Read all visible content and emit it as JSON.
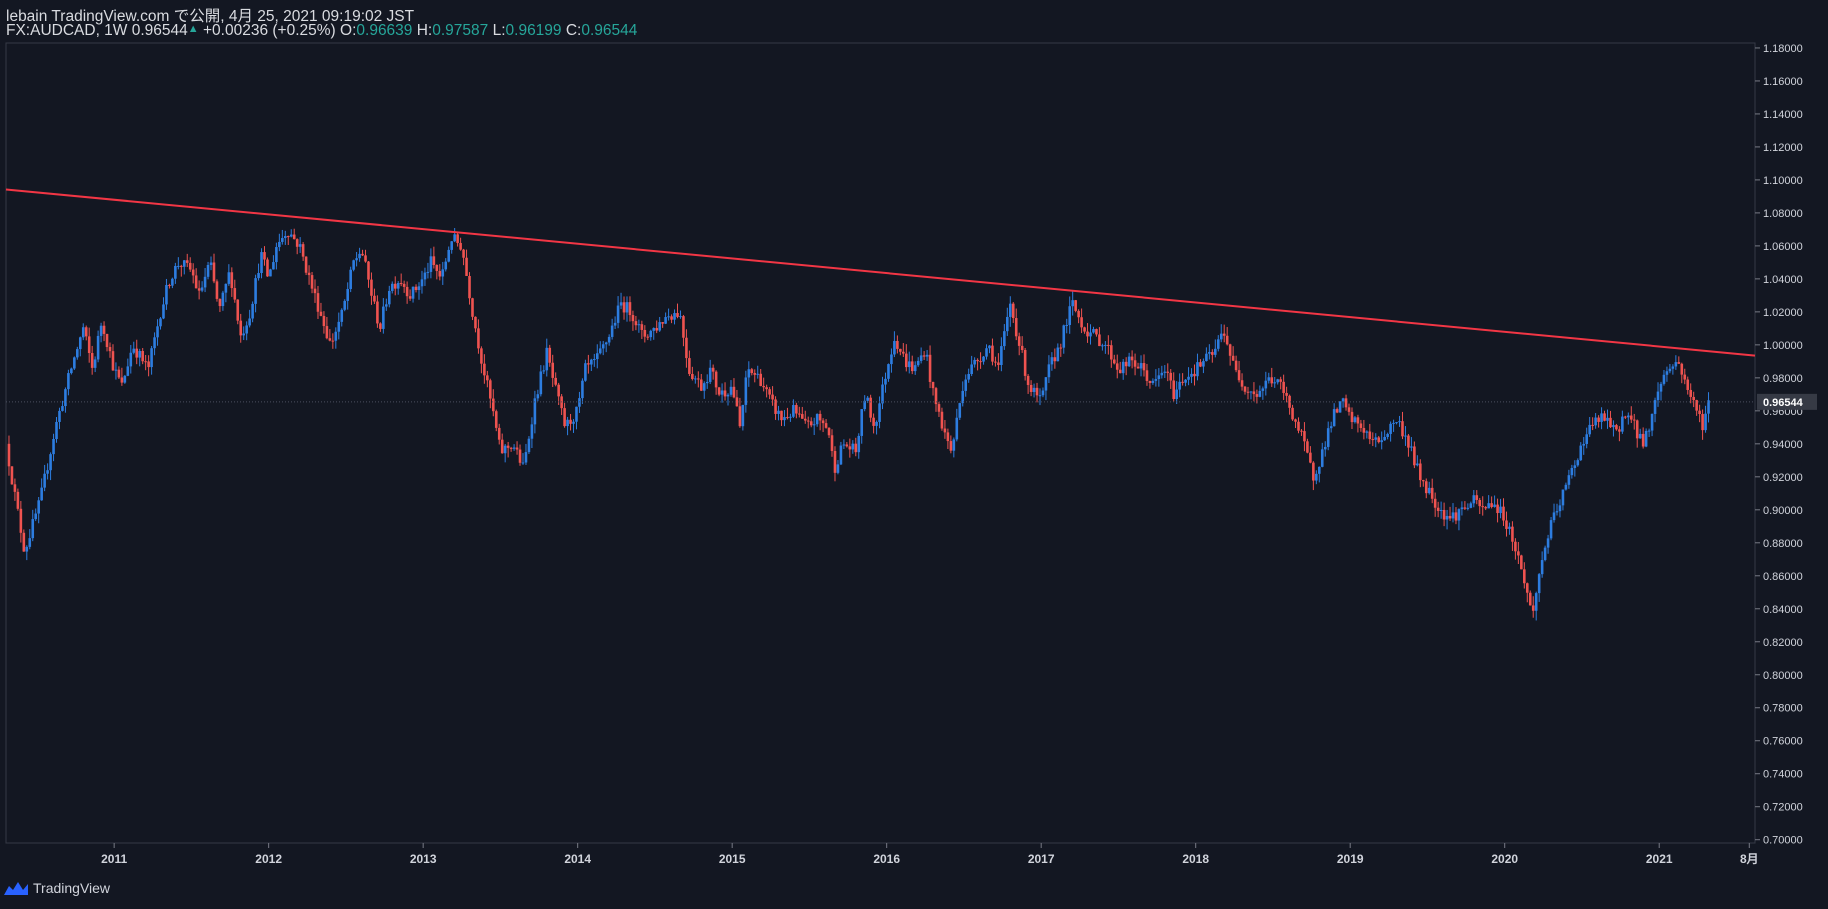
{
  "header": {
    "publish_text": "lebain TradingView.com で公開, 4月 25, 2021 09:19:02 JST",
    "symbol": "FX:AUDCAD, 1W",
    "last": "0.96544",
    "change": "+0.00236 (+0.25%)",
    "o_label": "O:",
    "o_value": "0.96639",
    "h_label": "H:",
    "h_value": "0.97587",
    "l_label": "L:",
    "l_value": "0.96199",
    "c_label": "C:",
    "c_value": "0.96544"
  },
  "footer": {
    "brand": "TradingView",
    "logo_icon": "tradingview-logo-icon"
  },
  "chart_data": {
    "type": "candlestick",
    "timeframe": "1W",
    "x_ticks": [
      "2011",
      "2012",
      "2013",
      "2014",
      "2015",
      "2016",
      "2017",
      "2018",
      "2019",
      "2020",
      "2021",
      "8月"
    ],
    "x_tick_years": [
      2011,
      2012,
      2013,
      2014,
      2015,
      2016,
      2017,
      2018,
      2019,
      2020,
      2021,
      2021.583
    ],
    "x_range": [
      2010.3,
      2021.62
    ],
    "y_ticks": [
      "1.18000",
      "1.16000",
      "1.14000",
      "1.12000",
      "1.10000",
      "1.08000",
      "1.06000",
      "1.04000",
      "1.02000",
      "1.00000",
      "0.98000",
      "0.96000",
      "0.94000",
      "0.92000",
      "0.90000",
      "0.88000",
      "0.86000",
      "0.84000",
      "0.82000",
      "0.80000",
      "0.78000",
      "0.76000",
      "0.74000",
      "0.72000",
      "0.70000"
    ],
    "ylim": [
      0.698,
      1.183
    ],
    "last_price_label": "0.96544",
    "last_price": 0.96544,
    "trendline": {
      "color": "#f23645",
      "from": [
        2010.3,
        1.0942
      ],
      "to": [
        2021.62,
        0.9935
      ]
    },
    "up_color": "#2d7de0",
    "down_color": "#ef5350",
    "closes_path": [
      [
        2010.3,
        0.94
      ],
      [
        2010.42,
        0.875
      ],
      [
        2010.52,
        0.905
      ],
      [
        2010.62,
        0.95
      ],
      [
        2010.72,
        0.985
      ],
      [
        2010.8,
        1.01
      ],
      [
        2010.86,
        0.985
      ],
      [
        2010.92,
        1.015
      ],
      [
        2011.0,
        0.985
      ],
      [
        2011.05,
        0.975
      ],
      [
        2011.12,
        1.0
      ],
      [
        2011.22,
        0.985
      ],
      [
        2011.3,
        1.02
      ],
      [
        2011.36,
        1.04
      ],
      [
        2011.42,
        1.05
      ],
      [
        2011.5,
        1.045
      ],
      [
        2011.55,
        1.03
      ],
      [
        2011.62,
        1.05
      ],
      [
        2011.68,
        1.02
      ],
      [
        2011.75,
        1.045
      ],
      [
        2011.82,
        1.005
      ],
      [
        2011.88,
        1.02
      ],
      [
        2011.95,
        1.055
      ],
      [
        2012.0,
        1.04
      ],
      [
        2012.05,
        1.06
      ],
      [
        2012.12,
        1.07
      ],
      [
        2012.2,
        1.06
      ],
      [
        2012.28,
        1.035
      ],
      [
        2012.35,
        1.015
      ],
      [
        2012.4,
        1.0
      ],
      [
        2012.48,
        1.02
      ],
      [
        2012.55,
        1.05
      ],
      [
        2012.6,
        1.058
      ],
      [
        2012.68,
        1.025
      ],
      [
        2012.72,
        1.01
      ],
      [
        2012.78,
        1.035
      ],
      [
        2012.85,
        1.04
      ],
      [
        2012.92,
        1.03
      ],
      [
        2013.0,
        1.04
      ],
      [
        2013.05,
        1.05
      ],
      [
        2013.12,
        1.04
      ],
      [
        2013.18,
        1.065
      ],
      [
        2013.25,
        1.06
      ],
      [
        2013.32,
        1.02
      ],
      [
        2013.38,
        0.99
      ],
      [
        2013.45,
        0.96
      ],
      [
        2013.5,
        0.935
      ],
      [
        2013.58,
        0.94
      ],
      [
        2013.65,
        0.925
      ],
      [
        2013.72,
        0.965
      ],
      [
        2013.8,
        0.995
      ],
      [
        2013.85,
        0.975
      ],
      [
        2013.92,
        0.95
      ],
      [
        2014.0,
        0.96
      ],
      [
        2014.05,
        0.985
      ],
      [
        2014.12,
        0.99
      ],
      [
        2014.2,
        1.005
      ],
      [
        2014.28,
        1.025
      ],
      [
        2014.35,
        1.02
      ],
      [
        2014.42,
        1.005
      ],
      [
        2014.5,
        1.01
      ],
      [
        2014.58,
        1.018
      ],
      [
        2014.66,
        1.02
      ],
      [
        2014.72,
        0.985
      ],
      [
        2014.8,
        0.975
      ],
      [
        2014.86,
        0.985
      ],
      [
        2014.92,
        0.97
      ],
      [
        2015.0,
        0.975
      ],
      [
        2015.05,
        0.95
      ],
      [
        2015.1,
        0.985
      ],
      [
        2015.18,
        0.98
      ],
      [
        2015.25,
        0.965
      ],
      [
        2015.32,
        0.955
      ],
      [
        2015.4,
        0.96
      ],
      [
        2015.48,
        0.95
      ],
      [
        2015.55,
        0.955
      ],
      [
        2015.62,
        0.95
      ],
      [
        2015.66,
        0.925
      ],
      [
        2015.72,
        0.94
      ],
      [
        2015.8,
        0.935
      ],
      [
        2015.86,
        0.97
      ],
      [
        2015.92,
        0.95
      ],
      [
        2016.0,
        0.985
      ],
      [
        2016.05,
        1.005
      ],
      [
        2016.12,
        0.99
      ],
      [
        2016.18,
        0.985
      ],
      [
        2016.25,
        0.998
      ],
      [
        2016.3,
        0.97
      ],
      [
        2016.38,
        0.945
      ],
      [
        2016.42,
        0.935
      ],
      [
        2016.5,
        0.98
      ],
      [
        2016.58,
        0.99
      ],
      [
        2016.66,
        1.0
      ],
      [
        2016.72,
        0.985
      ],
      [
        2016.8,
        1.025
      ],
      [
        2016.86,
        1.0
      ],
      [
        2016.92,
        0.975
      ],
      [
        2017.0,
        0.965
      ],
      [
        2017.05,
        0.985
      ],
      [
        2017.12,
        1.0
      ],
      [
        2017.2,
        1.025
      ],
      [
        2017.28,
        1.01
      ],
      [
        2017.35,
        1.005
      ],
      [
        2017.42,
        1.0
      ],
      [
        2017.5,
        0.985
      ],
      [
        2017.58,
        0.99
      ],
      [
        2017.66,
        0.985
      ],
      [
        2017.72,
        0.975
      ],
      [
        2017.8,
        0.985
      ],
      [
        2017.86,
        0.97
      ],
      [
        2017.92,
        0.98
      ],
      [
        2018.0,
        0.985
      ],
      [
        2018.05,
        0.99
      ],
      [
        2018.12,
        0.995
      ],
      [
        2018.18,
        1.01
      ],
      [
        2018.25,
        0.985
      ],
      [
        2018.32,
        0.975
      ],
      [
        2018.4,
        0.97
      ],
      [
        2018.48,
        0.98
      ],
      [
        2018.55,
        0.975
      ],
      [
        2018.62,
        0.96
      ],
      [
        2018.7,
        0.94
      ],
      [
        2018.76,
        0.92
      ],
      [
        2018.82,
        0.935
      ],
      [
        2018.88,
        0.955
      ],
      [
        2018.95,
        0.965
      ],
      [
        2019.0,
        0.955
      ],
      [
        2019.08,
        0.95
      ],
      [
        2019.15,
        0.94
      ],
      [
        2019.22,
        0.945
      ],
      [
        2019.3,
        0.955
      ],
      [
        2019.38,
        0.94
      ],
      [
        2019.45,
        0.92
      ],
      [
        2019.52,
        0.91
      ],
      [
        2019.58,
        0.9
      ],
      [
        2019.65,
        0.895
      ],
      [
        2019.72,
        0.9
      ],
      [
        2019.8,
        0.905
      ],
      [
        2019.86,
        0.9
      ],
      [
        2019.92,
        0.905
      ],
      [
        2020.0,
        0.895
      ],
      [
        2020.06,
        0.88
      ],
      [
        2020.12,
        0.86
      ],
      [
        2020.18,
        0.835
      ],
      [
        2020.22,
        0.86
      ],
      [
        2020.28,
        0.885
      ],
      [
        2020.36,
        0.905
      ],
      [
        2020.44,
        0.925
      ],
      [
        2020.52,
        0.945
      ],
      [
        2020.6,
        0.955
      ],
      [
        2020.66,
        0.955
      ],
      [
        2020.72,
        0.945
      ],
      [
        2020.78,
        0.96
      ],
      [
        2020.84,
        0.95
      ],
      [
        2020.9,
        0.94
      ],
      [
        2020.96,
        0.96
      ],
      [
        2021.0,
        0.975
      ],
      [
        2021.05,
        0.985
      ],
      [
        2021.12,
        0.99
      ],
      [
        2021.18,
        0.975
      ],
      [
        2021.24,
        0.96
      ],
      [
        2021.28,
        0.952
      ],
      [
        2021.32,
        0.9654
      ]
    ]
  }
}
